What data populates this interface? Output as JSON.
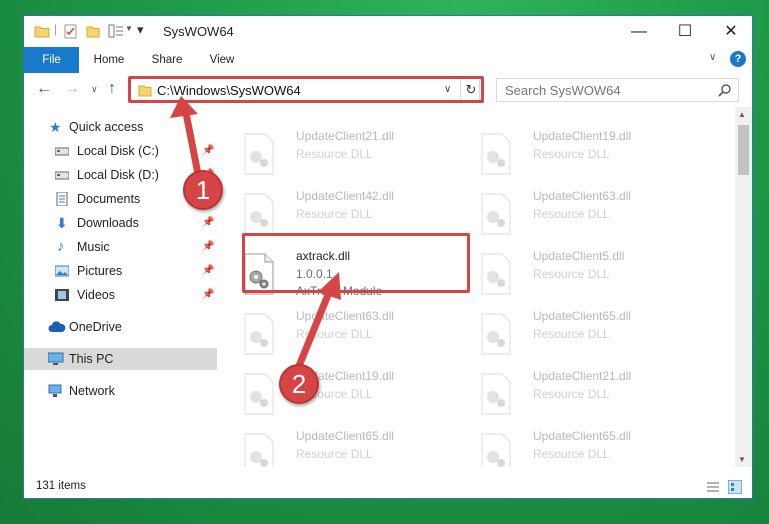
{
  "window": {
    "title": "SysWOW64",
    "controls": {
      "minimize": "—",
      "maximize": "☐",
      "close": "✕",
      "help": "?"
    }
  },
  "ribbon": {
    "tabs": [
      "File",
      "Home",
      "Share",
      "View"
    ]
  },
  "address": {
    "path": "C:\\Windows\\SysWOW64",
    "refresh": "↻"
  },
  "search": {
    "placeholder": "Search SysWOW64"
  },
  "nav_pane": {
    "quick_access": "Quick access",
    "items": [
      {
        "label": "Local Disk (C:)",
        "pinned": true
      },
      {
        "label": "Local Disk (D:)",
        "pinned": true
      },
      {
        "label": "Documents",
        "pinned": true
      },
      {
        "label": "Downloads",
        "pinned": true
      },
      {
        "label": "Music",
        "pinned": true
      },
      {
        "label": "Pictures",
        "pinned": true
      },
      {
        "label": "Videos",
        "pinned": true
      }
    ],
    "onedrive": "OneDrive",
    "this_pc": "This PC",
    "network": "Network"
  },
  "files": {
    "left": [
      {
        "name": "UpdateClient21.dll",
        "sub": "Resource DLL"
      },
      {
        "name": "UpdateClient42.dll",
        "sub": "Resource DLL"
      },
      {
        "name": "UpdateClient63.dll",
        "sub": "Resource DLL"
      },
      {
        "name": "UpdateClient19.dll",
        "sub": "Resource DLL"
      },
      {
        "name": "UpdateClient65.dll",
        "sub": "Resource DLL"
      }
    ],
    "highlighted": {
      "name": "axtrack.dll",
      "version": "1.0.0.1",
      "description": "AxTrack Module"
    },
    "right": [
      {
        "name": "UpdateClient19.dll",
        "sub": "Resource DLL"
      },
      {
        "name": "UpdateClient63.dll",
        "sub": "Resource DLL"
      },
      {
        "name": "UpdateClient5.dll",
        "sub": "Resource DLL"
      },
      {
        "name": "UpdateClient65.dll",
        "sub": "Resource DLL"
      },
      {
        "name": "UpdateClient21.dll",
        "sub": "Resource DLL"
      },
      {
        "name": "UpdateClient65.dll",
        "sub": "Resource DLL"
      }
    ]
  },
  "status": {
    "item_count": "131 items"
  },
  "annotations": {
    "step1": "1",
    "step2": "2"
  },
  "colors": {
    "accent": "#1979ca",
    "highlight": "#d64545",
    "selection": "#d9d9d9"
  }
}
